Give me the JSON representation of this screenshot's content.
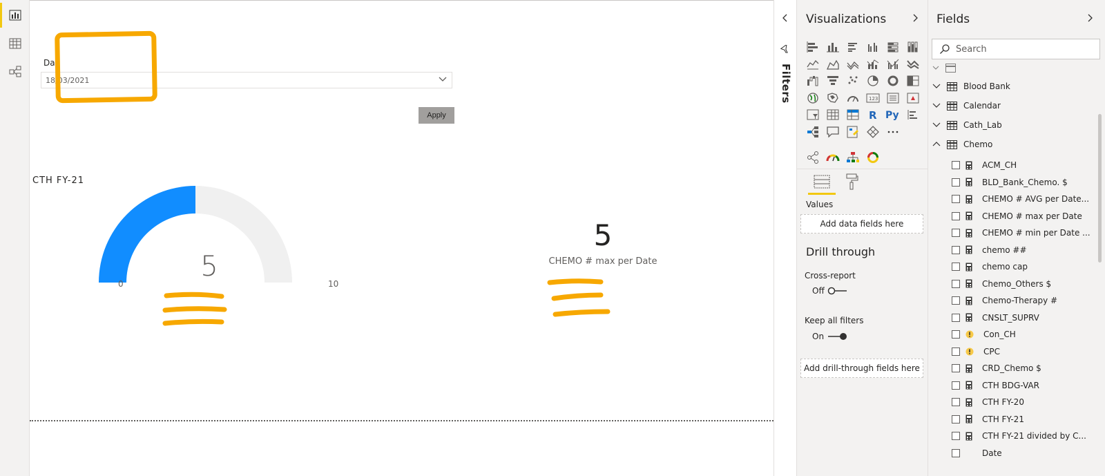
{
  "slicer": {
    "title": "Day",
    "value": "18/03/2021",
    "apply_label": "Apply"
  },
  "gauge": {
    "title": "CTH FY-21",
    "value": "5",
    "min": "0",
    "max": "10",
    "fill_fraction": 0.5,
    "fill_color": "#118dff",
    "track_color": "#f0f0f0"
  },
  "card": {
    "value": "5",
    "label": "CHEMO # max per Date"
  },
  "filters": {
    "label": "Filters"
  },
  "visualizations": {
    "title": "Visualizations",
    "icons": [
      "stacked-bar-icon",
      "stacked-column-icon",
      "clustered-bar-icon",
      "clustered-column-icon",
      "100-bar-icon",
      "100-column-icon",
      "line-chart-icon",
      "area-chart-icon",
      "stacked-area-icon",
      "line-column-icon",
      "line-clustered-icon",
      "ribbon-chart-icon",
      "waterfall-icon",
      "funnel-icon",
      "scatter-icon",
      "pie-icon",
      "donut-icon",
      "treemap-icon",
      "map-icon",
      "filled-map-icon",
      "gauge-icon",
      "card-icon",
      "multirow-card-icon",
      "kpi-icon",
      "slicer-icon",
      "table-icon",
      "matrix-icon",
      "r-visual-icon",
      "python-visual-icon",
      "key-influencers-icon",
      "decomposition-tree-icon",
      "qa-icon",
      "paginated-report-icon",
      "power-apps-icon",
      "more-icon"
    ],
    "custom_icons": [
      "network-icon",
      "speedometer-icon",
      "org-chart-icon",
      "ring-icon"
    ],
    "values_label": "Values",
    "values_drop": "Add data fields here",
    "drill_title": "Drill through",
    "cross_report_label": "Cross-report",
    "cross_report_state": "Off",
    "keep_filters_label": "Keep all filters",
    "keep_filters_state": "On",
    "drill_drop": "Add drill-through fields here"
  },
  "fields": {
    "title": "Fields",
    "search_placeholder": "Search",
    "tables": [
      "Blood Bank",
      "Calendar",
      "Cath_Lab",
      "Chemo"
    ],
    "chemo_fields": [
      {
        "name": "ACM_CH",
        "icon": "calc"
      },
      {
        "name": "BLD_Bank_Chemo. $",
        "icon": "calc"
      },
      {
        "name": "CHEMO # AVG per Date...",
        "icon": "calc"
      },
      {
        "name": "CHEMO # max per Date",
        "icon": "calc"
      },
      {
        "name": "CHEMO # min per Date ...",
        "icon": "calc"
      },
      {
        "name": "chemo ##",
        "icon": "calc"
      },
      {
        "name": "chemo cap",
        "icon": "calc"
      },
      {
        "name": "Chemo_Others $",
        "icon": "calc"
      },
      {
        "name": "Chemo-Therapy #",
        "icon": "calc"
      },
      {
        "name": "CNSLT_SUPRV",
        "icon": "calc"
      },
      {
        "name": "Con_CH",
        "icon": "warn"
      },
      {
        "name": "CPC",
        "icon": "warn"
      },
      {
        "name": "CRD_Chemo $",
        "icon": "calc"
      },
      {
        "name": "CTH BDG-VAR",
        "icon": "calc"
      },
      {
        "name": "CTH FY-20",
        "icon": "calc"
      },
      {
        "name": "CTH FY-21",
        "icon": "calc"
      },
      {
        "name": "CTH FY-21 divided by C...",
        "icon": "calc"
      },
      {
        "name": "Date",
        "icon": "none"
      }
    ]
  },
  "colors": {
    "accent": "#f2c811",
    "highlight": "#f7a800",
    "gauge_blue": "#118dff"
  }
}
